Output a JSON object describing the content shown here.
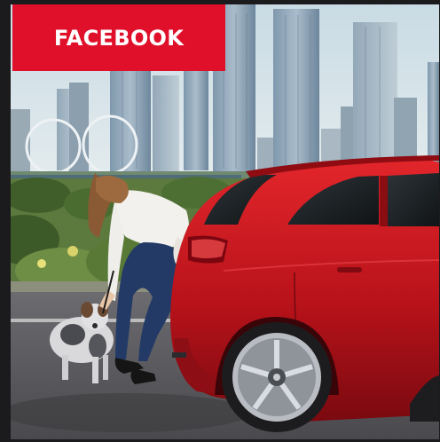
{
  "badge": {
    "label": "FACEBOOK",
    "color": "#e0102b"
  },
  "photo": {
    "subject": "woman-with-dog-and-red-hatchback-photo"
  },
  "colors": {
    "frame": "#1b1b1d",
    "car_red": "#c4141c",
    "sky": "#d6e4ea"
  }
}
